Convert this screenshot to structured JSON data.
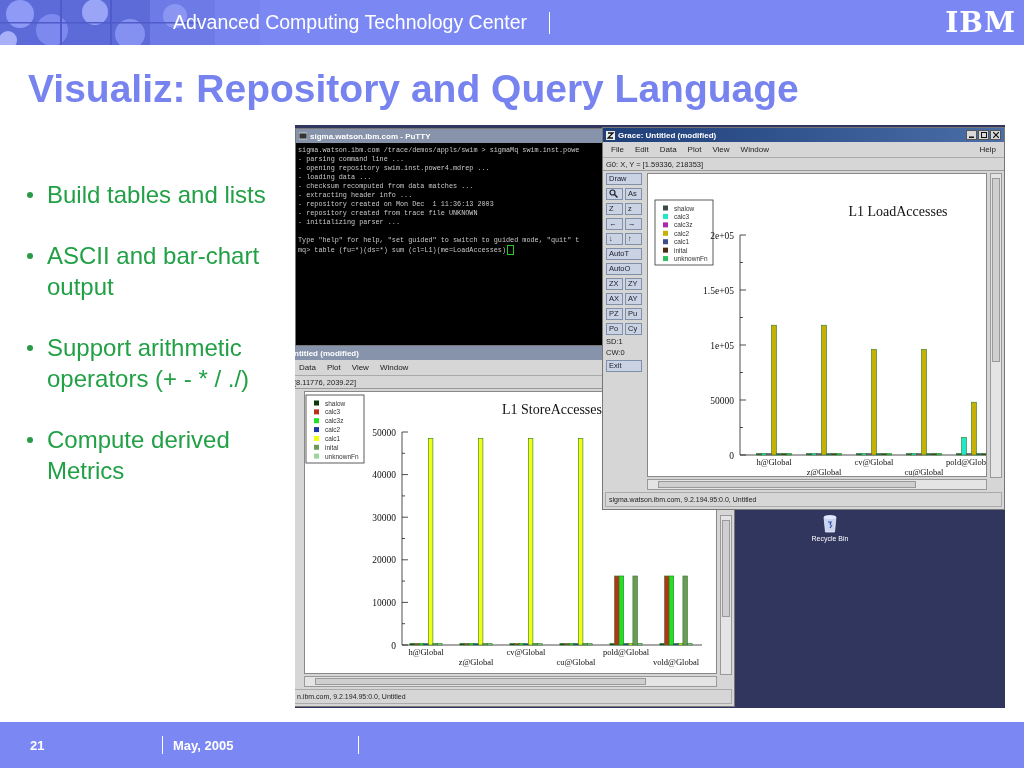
{
  "header": {
    "org": "Advanced Computing Technology Center",
    "logo": "IBM"
  },
  "title": "Visualiz: Repository and Query Language",
  "bullets": [
    "Build tables and lists",
    "ASCII and bar-chart output",
    "Support arithmetic operators (+ - * / ./)",
    "Compute derived Metrics"
  ],
  "desktop": {
    "windows": [
      {
        "kind": "terminal",
        "title": "sigma.watson.ibm.com - PuTTY",
        "lines": [
          "sigma.watson.ibm.com /trace/demos/appls/swim > sigmaMq swim.inst.powe",
          "- parsing command line ...",
          "- opening repository swim.inst.power4.mdrep ...",
          "- loading data ...",
          "- checksum recomputed from data matches ...",
          "- extracting header info ...",
          "- repository created on Mon Dec  1 11:36:13 2003",
          "- repository created from trace file UNKNOWN",
          "- initializing parser ..."
        ],
        "hint": "Type \"help\" for help, \"set guided\" to switch to guided mode, \"quit\" t",
        "input": "mq> table (fu=*)(ds=*) sum (cl=L1)(me=LoadAccesses)"
      },
      {
        "kind": "grace",
        "active": false,
        "title": "ntitled (modified)",
        "menu": [
          "Data",
          "Plot",
          "View",
          "Window"
        ],
        "coords": "[8.11776, 2039.22]",
        "status": "n.ibm.com, 9.2.194.95:0.0, Untitled",
        "chart_data": {
          "type": "bar",
          "title": "L1 StoreAccesses",
          "categories": [
            "h@Global",
            "z@Global",
            "cv@Global",
            "cu@Global",
            "pold@Global",
            "vold@Global"
          ],
          "series": [
            {
              "name": "shalow",
              "color": "#0a3a0a",
              "values": [
                0,
                0,
                0,
                0,
                0,
                0
              ]
            },
            {
              "name": "calc3",
              "color": "#b83218",
              "values": [
                0,
                0,
                0,
                0,
                16200,
                16200
              ]
            },
            {
              "name": "calc3z",
              "color": "#22e022",
              "values": [
                0,
                0,
                0,
                0,
                16200,
                16200
              ]
            },
            {
              "name": "calc2",
              "color": "#1838a8",
              "values": [
                0,
                0,
                0,
                0,
                0,
                0
              ]
            },
            {
              "name": "calc1",
              "color": "#f0ff10",
              "values": [
                48500,
                48500,
                48500,
                48500,
                0,
                0
              ]
            },
            {
              "name": "inital",
              "color": "#6e9a58",
              "values": [
                0,
                0,
                0,
                0,
                16200,
                16200
              ]
            },
            {
              "name": "unknownFn",
              "color": "#9ad89a",
              "values": [
                0,
                0,
                0,
                0,
                0,
                0
              ]
            }
          ],
          "ylim": [
            0,
            50000
          ],
          "yticks": [
            0,
            10000,
            20000,
            30000,
            40000,
            50000
          ],
          "legend": "upper left"
        }
      },
      {
        "kind": "grace",
        "active": true,
        "title": "Grace: Untitled (modified)",
        "menu": [
          "File",
          "Edit",
          "Data",
          "Plot",
          "View",
          "Window"
        ],
        "help": "Help",
        "coords": "G0: X, Y = [1.59336, 218353]",
        "tools": [
          {
            "kind": "wide",
            "label": "Draw"
          },
          {
            "kind": "zoom",
            "label": "As"
          },
          {
            "kind": "pair",
            "labels": [
              "Z",
              "z"
            ]
          },
          {
            "kind": "pair",
            "labels": [
              "←",
              "→"
            ]
          },
          {
            "kind": "pair",
            "labels": [
              "↓",
              "↑"
            ]
          },
          {
            "kind": "wide",
            "label": "AutoT"
          },
          {
            "kind": "wide",
            "label": "AutoO"
          },
          {
            "kind": "pair",
            "labels": [
              "ZX",
              "ZY"
            ]
          },
          {
            "kind": "pair",
            "labels": [
              "AX",
              "AY"
            ]
          },
          {
            "kind": "pair",
            "labels": [
              "PZ",
              "Pu"
            ]
          },
          {
            "kind": "pair",
            "labels": [
              "Po",
              "Cy"
            ]
          },
          {
            "kind": "text",
            "label": "SD:1"
          },
          {
            "kind": "text",
            "label": "CW:0"
          },
          {
            "kind": "wide",
            "label": "Exit"
          }
        ],
        "status": "sigma.watson.ibm.com, 9.2.194.95:0.0, Untitled",
        "chart_data": {
          "type": "bar",
          "title": "L1 LoadAccesses",
          "categories": [
            "h@Global",
            "z@Global",
            "cv@Global",
            "cu@Global",
            "pold@Glob"
          ],
          "series": [
            {
              "name": "shalow",
              "color": "#3a4a4a",
              "values": [
                0,
                0,
                0,
                0,
                0
              ]
            },
            {
              "name": "calc3",
              "color": "#20e8c8",
              "values": [
                0,
                0,
                0,
                0,
                16000
              ]
            },
            {
              "name": "calc3z",
              "color": "#b028b0",
              "values": [
                0,
                0,
                0,
                0,
                0
              ]
            },
            {
              "name": "calc2",
              "color": "#c8b000",
              "values": [
                118000,
                118000,
                96000,
                96000,
                48000
              ]
            },
            {
              "name": "calc1",
              "color": "#3c4c8c",
              "values": [
                0,
                0,
                0,
                0,
                0
              ]
            },
            {
              "name": "inital",
              "color": "#4a2a10",
              "values": [
                0,
                0,
                0,
                0,
                0
              ]
            },
            {
              "name": "unknownFn",
              "color": "#30c060",
              "values": [
                0,
                0,
                0,
                0,
                0
              ]
            }
          ],
          "ylim": [
            0,
            200000
          ],
          "legend": "upper left",
          "yticks": [
            {
              "value": 0,
              "label": "0"
            },
            {
              "value": 50000,
              "label": "50000"
            },
            {
              "value": 100000,
              "label": "1e+05"
            },
            {
              "value": 150000,
              "label": "1.5e+05"
            },
            {
              "value": 200000,
              "label": "2e+05"
            }
          ]
        }
      }
    ],
    "icons": [
      {
        "label": "Recycle Bin"
      }
    ]
  },
  "footer": {
    "page": "21",
    "date": "May, 2005"
  }
}
